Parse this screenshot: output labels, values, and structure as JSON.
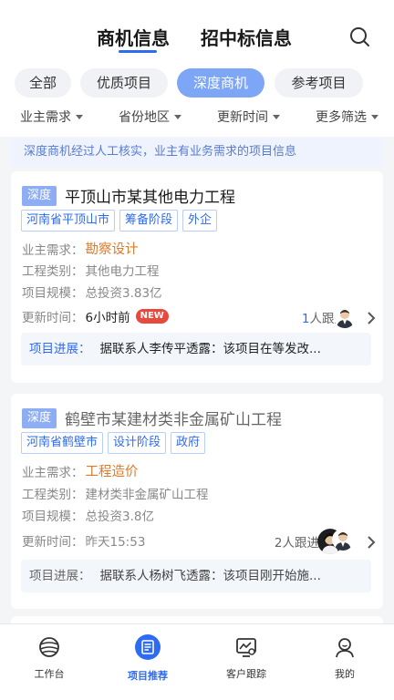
{
  "header": {
    "tabs": [
      {
        "label": "商机信息",
        "active": true
      },
      {
        "label": "招中标信息",
        "active": false
      }
    ],
    "search_icon": "search-icon"
  },
  "categories": [
    {
      "label": "全部",
      "active": false
    },
    {
      "label": "优质项目",
      "active": false
    },
    {
      "label": "深度商机",
      "active": true
    },
    {
      "label": "参考项目",
      "active": false
    }
  ],
  "filters": [
    "业主需求",
    "省份地区",
    "更新时间",
    "更多筛选"
  ],
  "notice": "深度商机经过人工核实，业主有业务需求的项目信息",
  "labels": {
    "demand": "业主需求：",
    "category": "工程类别：",
    "scale": "项目规模：",
    "updated": "更新时间：",
    "progress": "项目进展："
  },
  "cards": [
    {
      "badge": "深度",
      "title": "平顶山市某其他电力工程",
      "tags": [
        "河南省平顶山市",
        "筹备阶段",
        "外企"
      ],
      "demand": "勘察设计",
      "category": "其他电力工程",
      "scale": "总投资3.83亿",
      "updated": "6小时前",
      "new_badge": "NEW",
      "follow_count": "1",
      "follow_suffix": "人跟进",
      "progress": "据联系人李传平透露：该项目在等发改..."
    },
    {
      "badge": "深度",
      "title": "鹤壁市某建材类非金属矿山工程",
      "tags": [
        "河南省鹤壁市",
        "设计阶段",
        "政府"
      ],
      "demand": "工程造价",
      "category": "建材类非金属矿山工程",
      "scale": "总投资3.8亿",
      "updated": "昨天15:53",
      "follow_count": "2",
      "follow_suffix": "人跟进",
      "progress": "据联系人杨树飞透露：该项目刚开始施..."
    }
  ],
  "bottom_nav": [
    {
      "label": "工作台",
      "icon": "globe-icon",
      "active": false
    },
    {
      "label": "项目推荐",
      "icon": "document-icon",
      "active": true
    },
    {
      "label": "客户跟踪",
      "icon": "tracking-icon",
      "active": false
    },
    {
      "label": "我的",
      "icon": "profile-icon",
      "active": false
    }
  ],
  "colors": {
    "accent": "#2f6bf0",
    "chip_active": "#7da6f6",
    "orange": "#e07a28",
    "new_badge": "#e8493f"
  }
}
